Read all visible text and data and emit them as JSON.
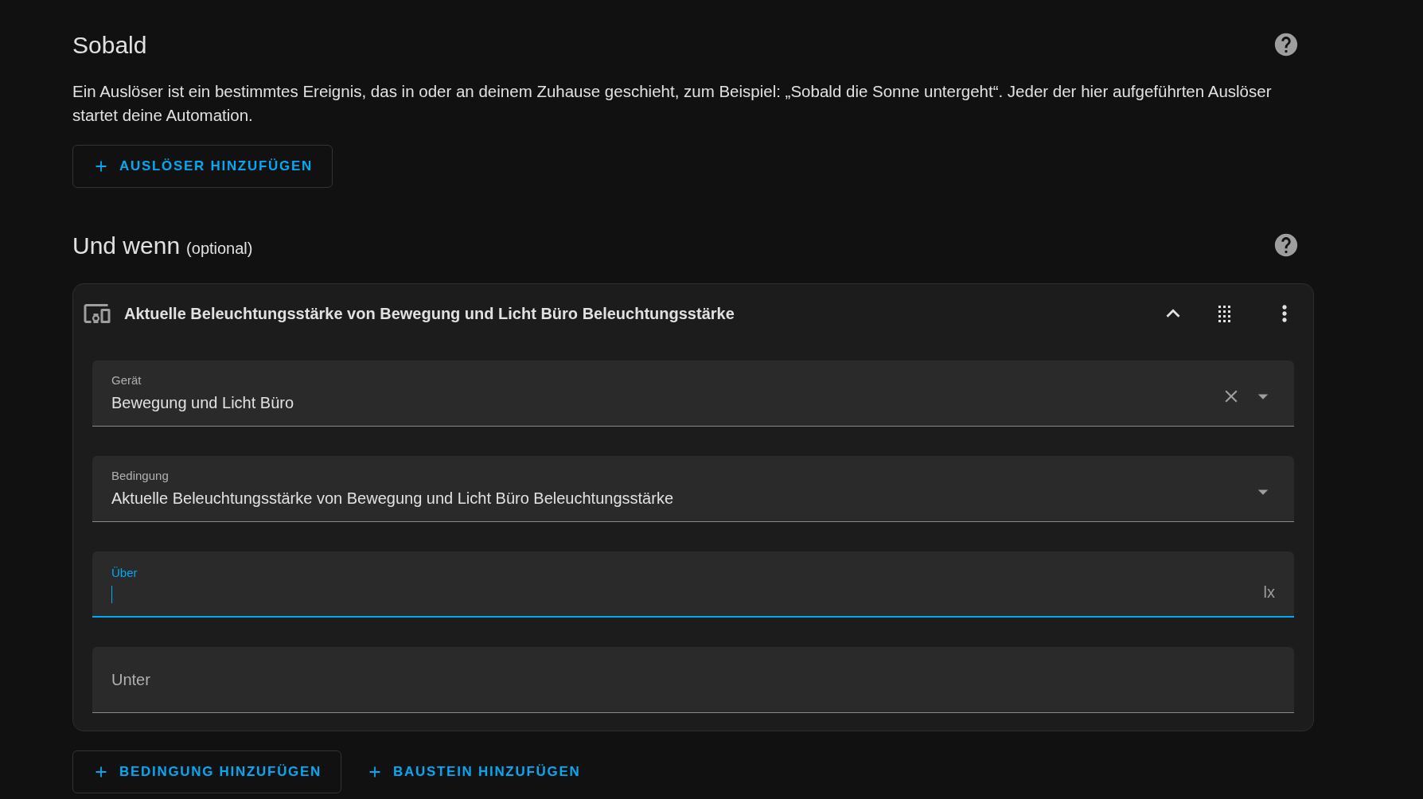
{
  "trigger_section": {
    "title": "Sobald",
    "description": "Ein Auslöser ist ein bestimmtes Ereignis, das in oder an deinem Zuhause geschieht, zum Beispiel: „Sobald die Sonne untergeht“. Jeder der hier aufgeführten Auslöser startet deine Automation.",
    "add_button": "AUSLÖSER HINZUFÜGEN"
  },
  "condition_section": {
    "title": "Und wenn",
    "optional_label": "(optional)",
    "card": {
      "title": "Aktuelle Beleuchtungsstärke von Bewegung und Licht Büro Beleuchtungsstärke",
      "expanded": true,
      "fields": [
        {
          "kind": "select",
          "label": "Gerät",
          "value": "Bewegung und Licht Büro",
          "clearable": true,
          "focused": false
        },
        {
          "kind": "select",
          "label": "Bedingung",
          "value": "Aktuelle Beleuchtungsstärke von Bewegung und Licht Büro Beleuchtungsstärke",
          "clearable": false,
          "focused": false
        },
        {
          "kind": "number",
          "label": "Über",
          "suffix": "lx",
          "focused": true
        },
        {
          "kind": "number",
          "label": "Unter",
          "focused": false
        }
      ]
    },
    "buttons": [
      {
        "label": "BEDINGUNG HINZUFÜGEN",
        "outlined": true
      },
      {
        "label": "BAUSTEIN HINZUFÜGEN",
        "outlined": false
      }
    ]
  }
}
